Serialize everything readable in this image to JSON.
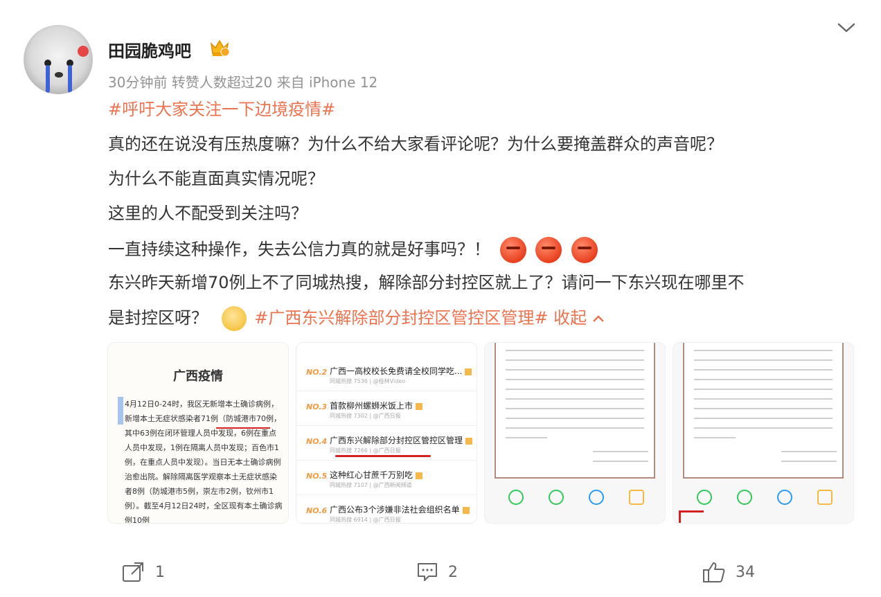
{
  "user": {
    "name": "田园脆鸡吧",
    "meta": "30分钟前  转赞人数超过20  来自 iPhone 12"
  },
  "post": {
    "hashtag_1": "#呼吁大家关注一下边境疫情#",
    "line_1": "真的还在说没有压热度嘛？为什么不给大家看评论呢？为什么要掩盖群众的声音呢？",
    "line_2": "为什么不能直面真实情况呢？",
    "line_3": "这里的人不配受到关注吗？",
    "line_4": "一直持续这种操作，失去公信力真的就是好事吗？！",
    "line_5": "东兴昨天新增70例上不了同城热搜，解除部分封控区就上了？请问一下东兴现在哪里不",
    "line_6": "是封控区呀？",
    "hashtag_2": "#广西东兴解除部分封控区管控区管理#",
    "collapse": "收起"
  },
  "images": {
    "image_1": {
      "title": "广西疫情",
      "text": "4月12日0-24时，我区无新增本土确诊病例，新增本土无症状感染者71例（防城港市70例，其中63例在闭环管理人员中发现，6例在重点人员中发现，1例在隔离人员中发现；百色市1例，在重点人员中发现）。当日无本土确诊病例治愈出院。解除隔离医学观察本土无症状感染者8例（防城港市5例，崇左市2例，钦州市1例）。截至4月12日24时，全区现有本土确诊病例10例"
    },
    "image_2": {
      "rows": [
        {
          "rank": "NO.2",
          "title": "广西一高校校长免费请全校同学吃...",
          "sub": "同城热搜 7536 | @桂林Video"
        },
        {
          "rank": "NO.3",
          "title": "首款柳州螺蛳米饭上市",
          "sub": "同城热搜 7302 | @广西日报"
        },
        {
          "rank": "NO.4",
          "title": "广西东兴解除部分封控区管控区管理",
          "sub": "同城热搜 7266 | @广西日报"
        },
        {
          "rank": "NO.5",
          "title": "这种红心甘蔗千万别吃",
          "sub": "同城热搜 7107 | @广西新闻频道"
        },
        {
          "rank": "NO.6",
          "title": "广西公布3个涉嫌非法社会组织名单",
          "sub": "同城热搜 6914 | @广西日报"
        }
      ]
    }
  },
  "actions": {
    "share_count": "1",
    "comment_count": "2",
    "like_count": "34"
  }
}
